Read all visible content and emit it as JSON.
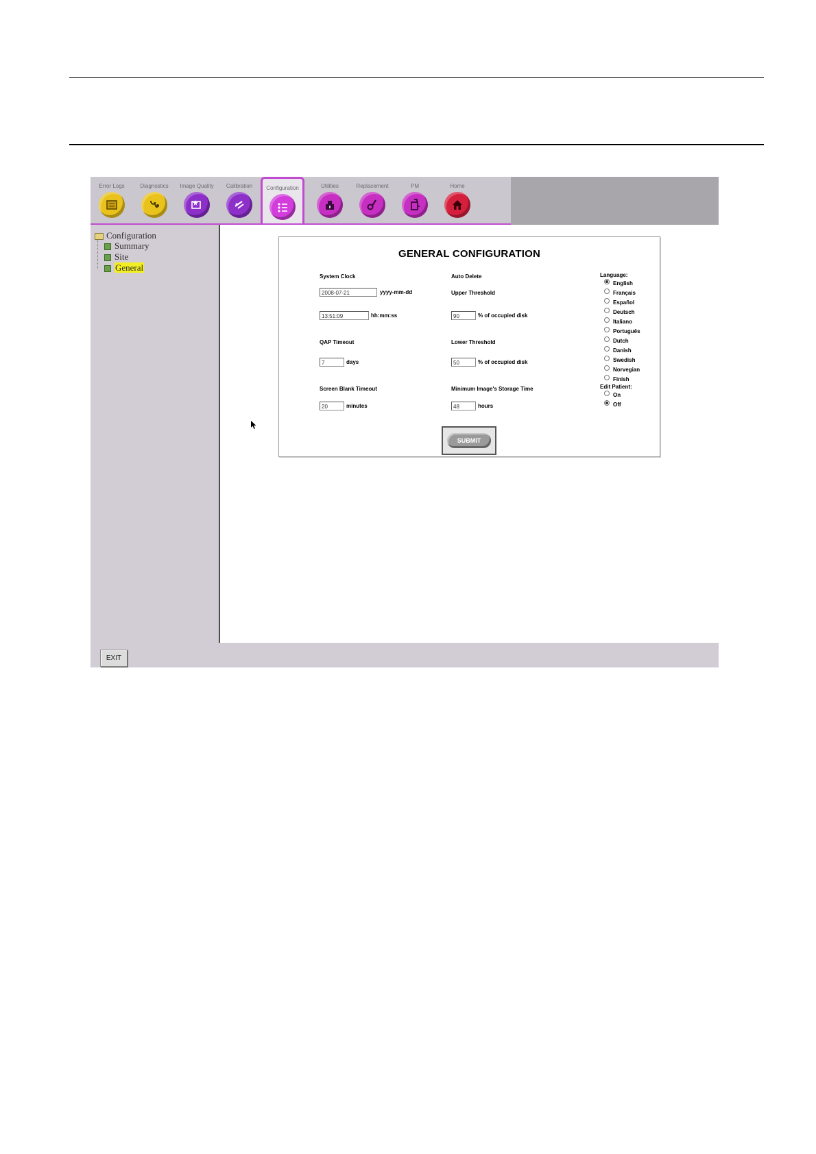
{
  "toolbar": {
    "tools": [
      {
        "label": "Error Logs",
        "icon": "error-logs-icon",
        "color": "#e9c21c"
      },
      {
        "label": "Diagnostics",
        "icon": "diagnostics-icon",
        "color": "#e9c21c"
      },
      {
        "label": "Image Quality",
        "icon": "image-quality-icon",
        "color": "#8d2fc9"
      },
      {
        "label": "Calibration",
        "icon": "calibration-icon",
        "color": "#8d2fc9"
      },
      {
        "label": "Configuration",
        "icon": "configuration-icon",
        "color": "#d23ddc",
        "active": true
      },
      {
        "label": "Utilities",
        "icon": "utilities-icon",
        "color": "#c62fc2"
      },
      {
        "label": "Replacement",
        "icon": "replacement-icon",
        "color": "#c62fc2"
      },
      {
        "label": "PM",
        "icon": "pm-icon",
        "color": "#c62fc2"
      },
      {
        "label": "Home",
        "icon": "home-icon",
        "color": "#d41f3d"
      }
    ]
  },
  "sidebar": {
    "root": "Configuration",
    "items": [
      {
        "label": "Summary"
      },
      {
        "label": "Site"
      },
      {
        "label": "General",
        "selected": true
      }
    ]
  },
  "form": {
    "title": "GENERAL CONFIGURATION",
    "system_clock": {
      "label": "System Clock",
      "date_value": "2008-07-21",
      "date_unit": "yyyy-mm-dd",
      "time_value": "13:51:09",
      "time_unit": "hh:mm:ss"
    },
    "qap_timeout": {
      "label": "QAP Timeout",
      "value": "7",
      "unit": "days"
    },
    "screen_blank_timeout": {
      "label": "Screen Blank Timeout",
      "value": "20",
      "unit": "minutes"
    },
    "auto_delete": {
      "label": "Auto Delete",
      "upper_label": "Upper Threshold",
      "upper_value": "90",
      "upper_unit": "% of occupied disk",
      "lower_label": "Lower Threshold",
      "lower_value": "50",
      "lower_unit": "% of occupied disk"
    },
    "min_storage": {
      "label": "Minimum Image's Storage Time",
      "value": "48",
      "unit": "hours"
    },
    "language": {
      "label": "Language:",
      "options": [
        "English",
        "Français",
        "Español",
        "Deutsch",
        "Italiano",
        "Português",
        "Dutch",
        "Danish",
        "Swedish",
        "Norvegian",
        "Finish"
      ],
      "selected": "English"
    },
    "edit_patient": {
      "label": "Edit Patient:",
      "options": [
        "On",
        "Off"
      ],
      "selected": "Off"
    },
    "submit_label": "SUBMIT"
  },
  "statusbar": {
    "exit_label": "EXIT"
  }
}
